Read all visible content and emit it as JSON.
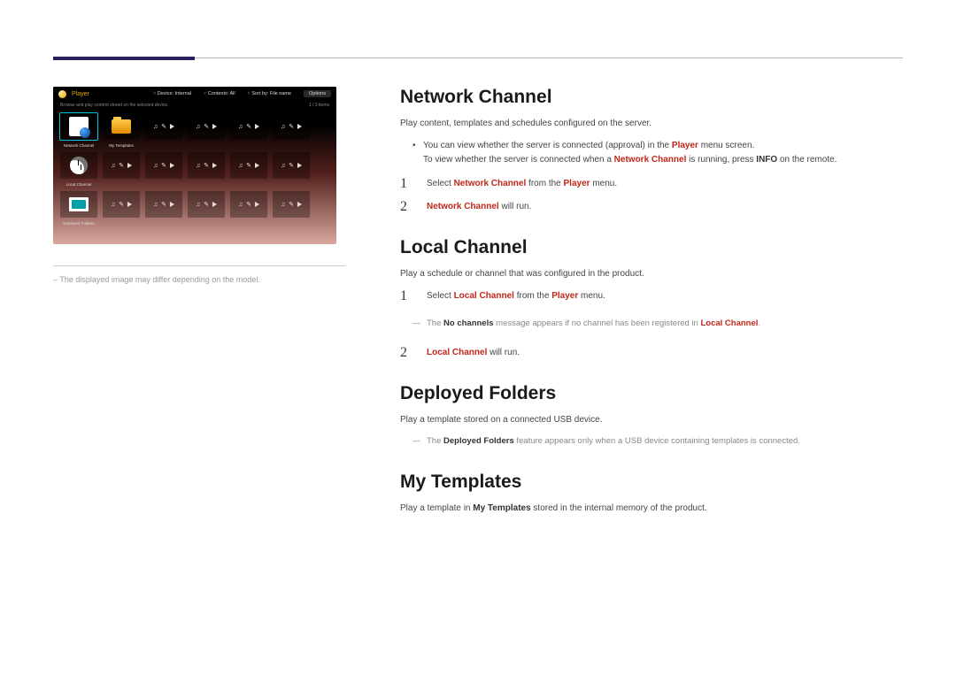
{
  "shot": {
    "player_label": "Player",
    "menu_device": "Device: Internal",
    "menu_contents": "Contents: All",
    "menu_sort": "Sort by: File name",
    "options_btn": "Options",
    "subtitle": "Browse and play content stored on the selected device.",
    "count": "1 / 3 items",
    "tile_network": "Network Channel",
    "tile_templates": "My Templates",
    "tile_local": "Local Channel",
    "tile_deployed": "Deployed Folders"
  },
  "left_note": "The displayed image may differ depending on the model.",
  "network": {
    "heading": "Network Channel",
    "intro": "Play content, templates and schedules configured on the server.",
    "bullet1_a": "You can view whether the server is connected (approval) in the ",
    "bullet1_b_hl": "Player",
    "bullet1_c": " menu screen.",
    "bullet2_a": "To view whether the server is connected when a ",
    "bullet2_b_hl": "Network Channel",
    "bullet2_c": " is running, press ",
    "bullet2_d_bold": "INFO",
    "bullet2_e": " on the remote.",
    "step1_a": "Select ",
    "step1_b_hl": "Network Channel",
    "step1_c": " from the ",
    "step1_d_hl": "Player",
    "step1_e": " menu.",
    "step2_a_hl": "Network Channel",
    "step2_b": " will run."
  },
  "local": {
    "heading": "Local Channel",
    "intro": "Play a schedule or channel that was configured in the product.",
    "step1_a": "Select ",
    "step1_b_hl": "Local Channel",
    "step1_c": " from the ",
    "step1_d_hl": "Player",
    "step1_e": " menu.",
    "note_a": "The ",
    "note_b_bold": "No channels",
    "note_c": " message appears if no channel has been registered in ",
    "note_d_hl": "Local Channel",
    "note_e": ".",
    "step2_a_hl": "Local Channel",
    "step2_b": " will run."
  },
  "deployed": {
    "heading": "Deployed Folders",
    "intro": "Play a template stored on a connected USB device.",
    "note_a": "The ",
    "note_b_bold": "Deployed Folders",
    "note_c": " feature appears only when a USB device containing templates is connected."
  },
  "mytemplates": {
    "heading": "My Templates",
    "intro_a": "Play a template in ",
    "intro_b_bold": "My Templates",
    "intro_c": " stored in the internal memory of the product."
  },
  "nums": {
    "one": "1",
    "two": "2"
  }
}
